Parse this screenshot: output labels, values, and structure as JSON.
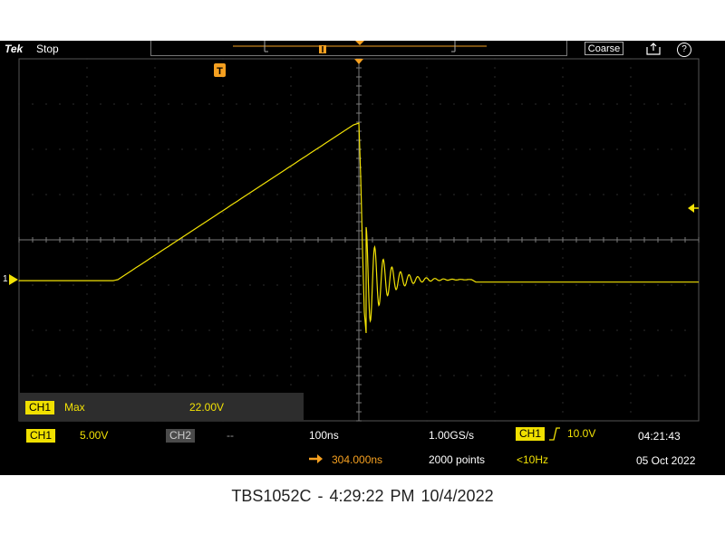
{
  "topbar": {
    "brand": "Tek",
    "state": "Stop",
    "trigger_mark": "T",
    "coarse_label": "Coarse",
    "help_label": "?"
  },
  "measurement": {
    "channel": "CH1",
    "type": "Max",
    "value": "22.00V"
  },
  "channel_marker": "1",
  "status": {
    "ch1_label": "CH1",
    "ch1_scale": "5.00V",
    "ch2_label": "CH2",
    "ch2_scale": "--",
    "time_div": "100ns",
    "horiz_position": "304.000ns",
    "sample_rate": "1.00GS/s",
    "record_length": "2000 points",
    "trigger_source": "CH1",
    "trigger_level": "10.0V",
    "trigger_freq": "<10Hz",
    "time": "04:21:43",
    "date": "05 Oct 2022"
  },
  "caption": "TBS1052C - 4:29:22 PM   10/4/2022",
  "colors": {
    "trace": "#f2e205",
    "accent_orange": "#f5a020",
    "background": "#000000"
  },
  "icons": [
    "save-icon",
    "help-icon",
    "trigger-marker-icon",
    "trigger-level-icon",
    "channel-ground-icon",
    "rising-edge-icon",
    "arrow-right-icon"
  ]
}
